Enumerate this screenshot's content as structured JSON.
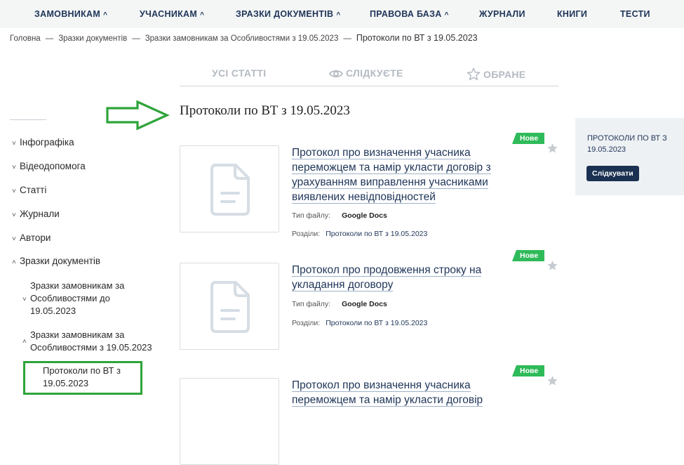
{
  "topnav": {
    "items": [
      {
        "label": "ЗАМОВНИКАМ",
        "caret": "^"
      },
      {
        "label": "УЧАСНИКАМ",
        "caret": "^"
      },
      {
        "label": "ЗРАЗКИ ДОКУМЕНТІВ",
        "caret": "^"
      },
      {
        "label": "ПРАВОВА БАЗА",
        "caret": "^"
      },
      {
        "label": "ЖУРНАЛИ",
        "caret": ""
      },
      {
        "label": "КНИГИ",
        "caret": ""
      },
      {
        "label": "ТЕСТИ",
        "caret": ""
      }
    ]
  },
  "breadcrumb": {
    "items": [
      "Головна",
      "Зразки документів",
      "Зразки замовникам за Особливостями з 19.05.2023"
    ],
    "separator": "—",
    "current": "Протоколи по ВТ з 19.05.2023"
  },
  "filter_tabs": [
    {
      "label": "УСІ СТАТТІ",
      "icon": ""
    },
    {
      "label": "СЛІДКУЄТЕ",
      "icon": "eye-icon"
    },
    {
      "label": "ОБРАНЕ",
      "icon": "star-outline-icon"
    }
  ],
  "sidebar": {
    "items": [
      {
        "label": "Інфографіка",
        "chevron": "˅"
      },
      {
        "label": "Відеодопомога",
        "chevron": "˅"
      },
      {
        "label": "Статті",
        "chevron": "˅"
      },
      {
        "label": "Журнали",
        "chevron": "˅"
      },
      {
        "label": "Автори",
        "chevron": "˅"
      },
      {
        "label": "Зразки документів",
        "chevron": "˄"
      }
    ],
    "subitems": [
      {
        "label": "Зразки замовникам за Особливостями до 19.05.2023",
        "chevron": "˅"
      },
      {
        "label": "Зразки замовникам за Особливостями з 19.05.2023",
        "chevron": "˄"
      },
      {
        "label": "Протоколи по ВТ з 19.05.2023",
        "chevron": ""
      }
    ]
  },
  "page": {
    "title": "Протоколи по ВТ з 19.05.2023"
  },
  "articles": [
    {
      "title": "Протокол про визначення учасника переможцем та намір укласти договір з урахуванням виправлення учасниками виявлених невідповідностей",
      "badge": "Нове",
      "file_type_label": "Тип файлу:",
      "file_type": "Google Docs",
      "sections_label": "Розділи:",
      "section": "Протоколи по ВТ з 19.05.2023"
    },
    {
      "title": "Протокол про продовження строку на укладання договору",
      "badge": "Нове",
      "file_type_label": "Тип файлу:",
      "file_type": "Google Docs",
      "sections_label": "Розділи:",
      "section": "Протоколи по ВТ з 19.05.2023"
    },
    {
      "title": "Протокол про визначення учасника переможцем та намір укласти договір",
      "badge": "Нове"
    }
  ],
  "follow_panel": {
    "title": "ПРОТОКОЛИ ПО ВТ З 19.05.2023",
    "button": "Слідкувати"
  },
  "colors": {
    "nav_text": "#1f3558",
    "badge_green": "#2fba5a",
    "annotation_green": "#2ea43a",
    "follow_button": "#1b3152",
    "panel_bg": "#eef1f4"
  }
}
